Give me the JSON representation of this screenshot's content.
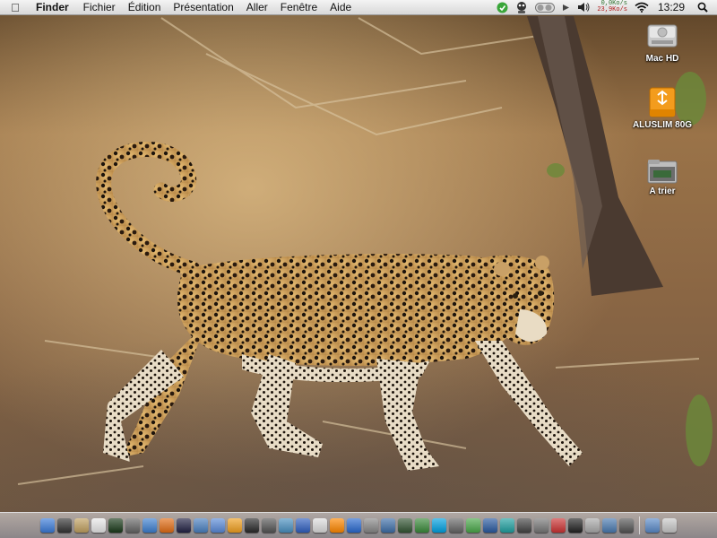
{
  "menubar": {
    "app_name": "Finder",
    "items": [
      "Fichier",
      "Édition",
      "Présentation",
      "Aller",
      "Fenêtre",
      "Aide"
    ],
    "net_up": "0,0Ko/s",
    "net_down": "23,9Ko/s",
    "clock": "13:29",
    "status_icons": [
      "evernote-icon",
      "growl-icon",
      "istat-icon",
      "play-icon",
      "volume-icon",
      "wifi-icon",
      "spotlight-icon"
    ]
  },
  "desktop": {
    "icons": [
      {
        "label": "Mac HD",
        "icon": "hard-drive-icon"
      },
      {
        "label": "ALUSLIM 80G",
        "icon": "firewire-drive-icon"
      },
      {
        "label": "A trier",
        "icon": "folder-icon"
      }
    ],
    "wallpaper": "leopard-walking-photo"
  },
  "dock": {
    "apps": [
      {
        "icon": "finder-icon",
        "color": "#3b7bd8"
      },
      {
        "icon": "mac-os-x-icon",
        "color": "#333333"
      },
      {
        "icon": "preview-icon",
        "color": "#c0a060"
      },
      {
        "icon": "ical-icon",
        "color": "#e8e8e8"
      },
      {
        "icon": "activity-monitor-icon",
        "color": "#1a3a1a"
      },
      {
        "icon": "vmware-icon",
        "color": "#666666"
      },
      {
        "icon": "safari-icon",
        "color": "#3d7fd0"
      },
      {
        "icon": "firefox-icon",
        "color": "#e26d15"
      },
      {
        "icon": "camino-icon",
        "color": "#222244"
      },
      {
        "icon": "safari-2-icon",
        "color": "#4a80c0"
      },
      {
        "icon": "itunes-icon",
        "color": "#5a8ad8"
      },
      {
        "icon": "skype-icon",
        "color": "#f0a020"
      },
      {
        "icon": "adium-icon",
        "color": "#2a2a2a"
      },
      {
        "icon": "photoshop-icon",
        "color": "#555555"
      },
      {
        "icon": "iphoto-icon",
        "color": "#4a90c0"
      },
      {
        "icon": "word-icon",
        "color": "#3060c0"
      },
      {
        "icon": "textedit-icon",
        "color": "#dddddd"
      },
      {
        "icon": "vlc-icon",
        "color": "#ff8800"
      },
      {
        "icon": "ie-icon",
        "color": "#2a6ad0"
      },
      {
        "icon": "help-icon",
        "color": "#888888"
      },
      {
        "icon": "preview-2-icon",
        "color": "#3f6fa8"
      },
      {
        "icon": "growl-2-icon",
        "color": "#335533"
      },
      {
        "icon": "people-icon",
        "color": "#3a8a3a"
      },
      {
        "icon": "skype-2-icon",
        "color": "#00a0e0"
      },
      {
        "icon": "dashcode-icon",
        "color": "#666666"
      },
      {
        "icon": "utorrent-icon",
        "color": "#4aa84a"
      },
      {
        "icon": "network-icon",
        "color": "#2a5aa0"
      },
      {
        "icon": "app-store-icon",
        "color": "#20a0a0"
      },
      {
        "icon": "console-icon",
        "color": "#444444"
      },
      {
        "icon": "disk-utility-icon",
        "color": "#777777"
      },
      {
        "icon": "garageband-icon",
        "color": "#cc3333"
      },
      {
        "icon": "dvd-player-icon",
        "color": "#222222"
      },
      {
        "icon": "system-prefs-icon",
        "color": "#aaaaaa"
      },
      {
        "icon": "screenshot-icon",
        "color": "#4a7ab0"
      },
      {
        "icon": "automator-icon",
        "color": "#555555"
      }
    ],
    "docs": [
      {
        "icon": "downloads-stack-icon",
        "color": "#5a8ac8"
      },
      {
        "icon": "trash-icon",
        "color": "#c8c8c8"
      }
    ]
  }
}
